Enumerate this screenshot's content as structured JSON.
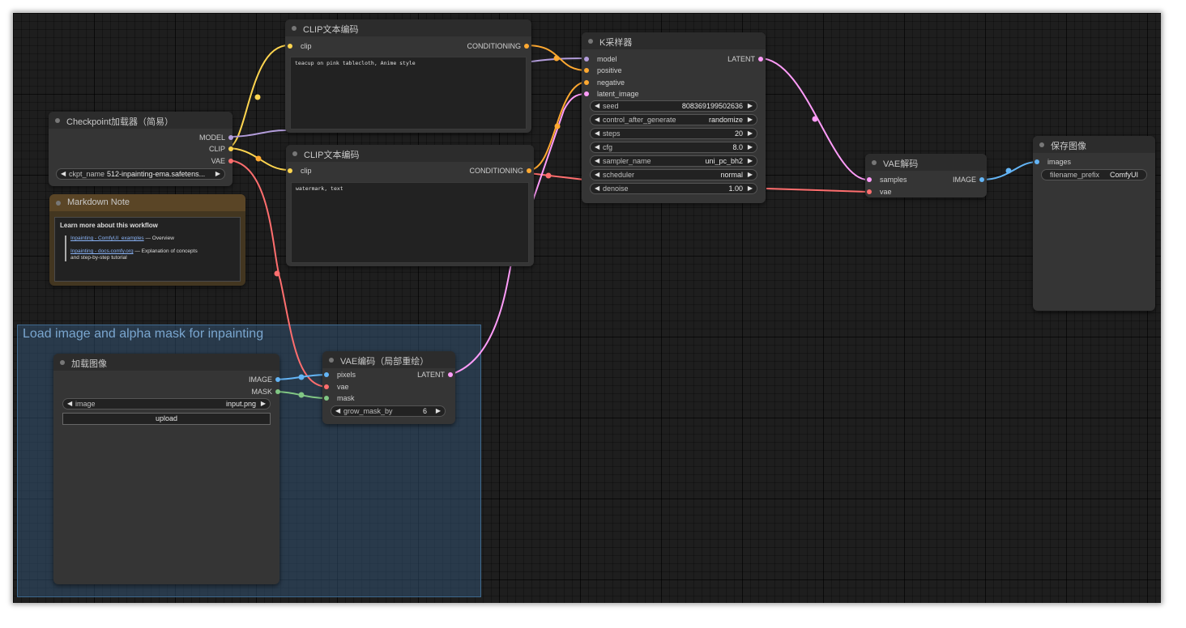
{
  "group": {
    "title": "Load image and alpha mask for inpainting"
  },
  "colors": {
    "model": "#b39ddb",
    "clip": "#ffd54f",
    "vae": "#ff6e6e",
    "conditioning": "#ffa931",
    "latent": "#ff9cf9",
    "image": "#64b5f6",
    "mask": "#81c784"
  },
  "nodes": {
    "checkpoint": {
      "title": "Checkpoint加载器（简易）",
      "outputs": [
        "MODEL",
        "CLIP",
        "VAE"
      ],
      "widget": {
        "label": "ckpt_name",
        "value": "512-inpainting-ema.safetens..."
      }
    },
    "note": {
      "title": "Markdown Note",
      "heading": "Learn more about this workflow",
      "link1": "Inpainting - ComfyUI_examples",
      "link1_desc": " — Overview",
      "link2": "Inpainting - docs.comfy.org",
      "link2_desc": " — Explanation of concepts",
      "link2_desc2": "and step-by-step tutorial"
    },
    "clip_pos": {
      "title": "CLIP文本编码",
      "input": "clip",
      "output": "CONDITIONING",
      "text": "teacup on pink tablecloth, Anime style"
    },
    "clip_neg": {
      "title": "CLIP文本编码",
      "input": "clip",
      "output": "CONDITIONING",
      "text": "watermark, text"
    },
    "ksampler": {
      "title": "K采样器",
      "inputs": [
        "model",
        "positive",
        "negative",
        "latent_image"
      ],
      "output": "LATENT",
      "widgets": [
        {
          "label": "seed",
          "value": "808369199502636"
        },
        {
          "label": "control_after_generate",
          "value": "randomize"
        },
        {
          "label": "steps",
          "value": "20"
        },
        {
          "label": "cfg",
          "value": "8.0"
        },
        {
          "label": "sampler_name",
          "value": "uni_pc_bh2"
        },
        {
          "label": "scheduler",
          "value": "normal"
        },
        {
          "label": "denoise",
          "value": "1.00"
        }
      ]
    },
    "vae_decode": {
      "title": "VAE解码",
      "inputs": [
        "samples",
        "vae"
      ],
      "output": "IMAGE"
    },
    "save": {
      "title": "保存图像",
      "input": "images",
      "widget": {
        "label": "filename_prefix",
        "value": "ComfyUI"
      }
    },
    "load_image": {
      "title": "加载图像",
      "outputs": [
        "IMAGE",
        "MASK"
      ],
      "widget": {
        "label": "image",
        "value": "input.png"
      },
      "button": "upload"
    },
    "vae_encode": {
      "title": "VAE编码（局部重绘）",
      "inputs": [
        "pixels",
        "vae",
        "mask"
      ],
      "output": "LATENT",
      "widget": {
        "label": "grow_mask_by",
        "value": "6"
      }
    }
  }
}
